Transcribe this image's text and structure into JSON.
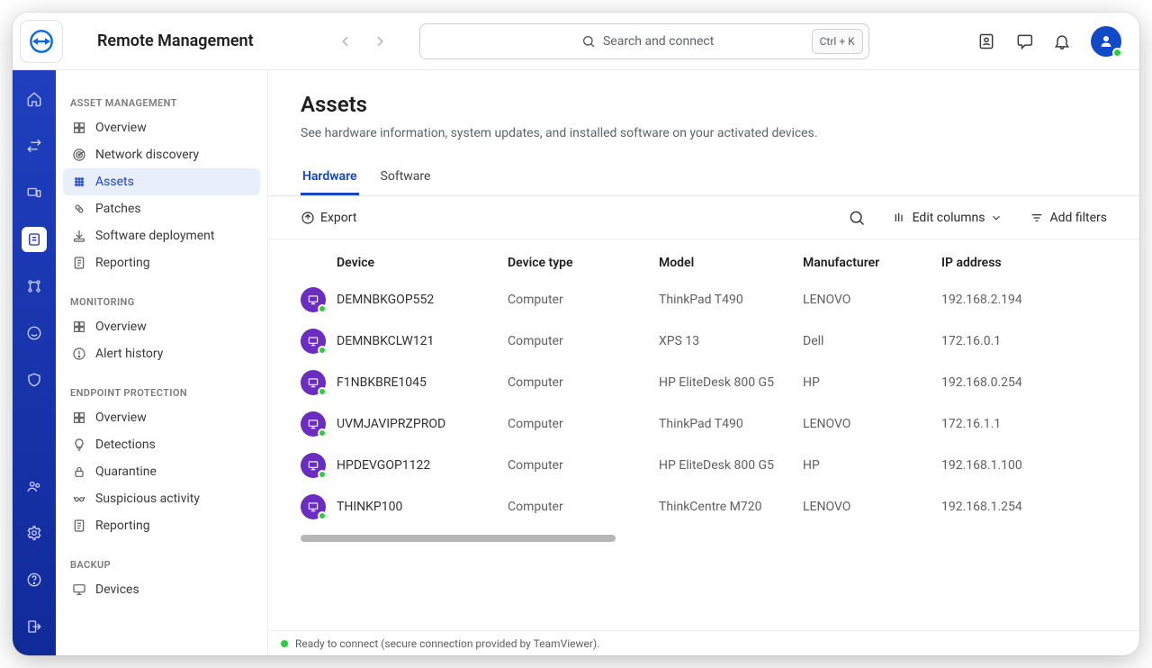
{
  "app": {
    "title": "Remote Management",
    "search_placeholder": "Search and connect",
    "shortcut": "Ctrl + K"
  },
  "rail": [
    {
      "name": "home"
    },
    {
      "name": "swap"
    },
    {
      "name": "devices"
    },
    {
      "name": "assets",
      "active": true
    },
    {
      "name": "workflow"
    },
    {
      "name": "support"
    },
    {
      "name": "shield"
    }
  ],
  "rail_bottom": [
    {
      "name": "users"
    },
    {
      "name": "settings"
    },
    {
      "name": "help"
    },
    {
      "name": "exit"
    }
  ],
  "sidebar": {
    "groups": [
      {
        "heading": "ASSET MANAGEMENT",
        "items": [
          {
            "label": "Overview",
            "icon": "dashboard"
          },
          {
            "label": "Network discovery",
            "icon": "radar"
          },
          {
            "label": "Assets",
            "icon": "grid",
            "active": true
          },
          {
            "label": "Patches",
            "icon": "patch"
          },
          {
            "label": "Software deployment",
            "icon": "deploy"
          },
          {
            "label": "Reporting",
            "icon": "report"
          }
        ]
      },
      {
        "heading": "MONITORING",
        "items": [
          {
            "label": "Overview",
            "icon": "dashboard"
          },
          {
            "label": "Alert history",
            "icon": "alert"
          }
        ]
      },
      {
        "heading": "ENDPOINT PROTECTION",
        "items": [
          {
            "label": "Overview",
            "icon": "dashboard"
          },
          {
            "label": "Detections",
            "icon": "lamp"
          },
          {
            "label": "Quarantine",
            "icon": "lock"
          },
          {
            "label": "Suspicious activity",
            "icon": "mask"
          },
          {
            "label": "Reporting",
            "icon": "report"
          }
        ]
      },
      {
        "heading": "BACKUP",
        "items": [
          {
            "label": "Devices",
            "icon": "monitor"
          }
        ]
      }
    ]
  },
  "page": {
    "title": "Assets",
    "subtitle": "See hardware information, system updates, and installed software on your activated devices."
  },
  "tabs": [
    {
      "label": "Hardware",
      "active": true
    },
    {
      "label": "Software"
    }
  ],
  "toolbar": {
    "export": "Export",
    "edit_columns": "Edit columns",
    "add_filters": "Add filters"
  },
  "table": {
    "columns": [
      "Device",
      "Device type",
      "Model",
      "Manufacturer",
      "IP address"
    ],
    "rows": [
      {
        "device": "DEMNBKGOP552",
        "type": "Computer",
        "model": "ThinkPad T490",
        "manufacturer": "LENOVO",
        "ip": "192.168.2.194"
      },
      {
        "device": "DEMNBKCLW121",
        "type": "Computer",
        "model": "XPS 13",
        "manufacturer": "Dell",
        "ip": "172.16.0.1"
      },
      {
        "device": "F1NBKBRE1045",
        "type": "Computer",
        "model": "HP EliteDesk 800 G5",
        "manufacturer": "HP",
        "ip": "192.168.0.254"
      },
      {
        "device": "UVMJAVIPRZPROD",
        "type": "Computer",
        "model": "ThinkPad T490",
        "manufacturer": "LENOVO",
        "ip": "172.16.1.1"
      },
      {
        "device": "HPDEVGOP1122",
        "type": "Computer",
        "model": "HP EliteDesk 800 G5",
        "manufacturer": "HP",
        "ip": "192.168.1.100"
      },
      {
        "device": "THINKP100",
        "type": "Computer",
        "model": "ThinkCentre M720",
        "manufacturer": "LENOVO",
        "ip": "192.168.1.254"
      }
    ]
  },
  "status": {
    "text": "Ready to connect (secure connection provided by TeamViewer)."
  }
}
